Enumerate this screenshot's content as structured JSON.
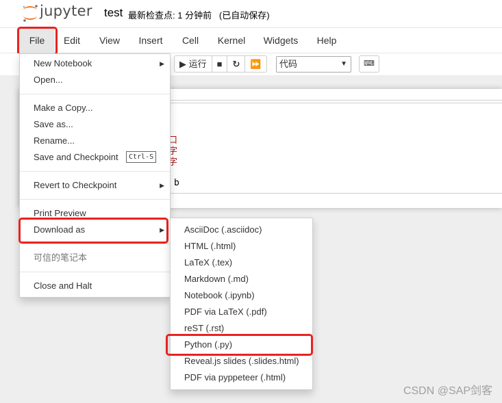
{
  "header": {
    "logo_text": "jupyter",
    "notebook_title": "test",
    "save_status": "最新检查点: 1 分钟前   (已自动保存)"
  },
  "menubar": {
    "items": [
      "File",
      "Edit",
      "View",
      "Insert",
      "Cell",
      "Kernel",
      "Widgets",
      "Help"
    ]
  },
  "toolbar": {
    "run_label": "▶ 运行",
    "stop_icon": "stop-icon",
    "restart_icon": "restart-icon",
    "fast_forward_icon": "fast-forward-icon",
    "cell_type": "代码",
    "keyboard_icon": "keyboard-icon"
  },
  "notebook": {
    "fragments": [
      "口",
      "字",
      "字",
      "b"
    ]
  },
  "file_menu": {
    "items": [
      {
        "label": "New Notebook",
        "has_submenu": true
      },
      {
        "label": "Open..."
      },
      {
        "label": "Make a Copy..."
      },
      {
        "label": "Save as..."
      },
      {
        "label": "Rename..."
      },
      {
        "label": "Save and Checkpoint",
        "shortcut": "Ctrl-S"
      },
      {
        "label": "Revert to Checkpoint",
        "has_submenu": true
      },
      {
        "label": "Print Preview"
      },
      {
        "label": "Download as",
        "has_submenu": true
      },
      {
        "label": "可信的笔记本",
        "disabled": true
      },
      {
        "label": "Close and Halt"
      }
    ]
  },
  "download_submenu": {
    "items": [
      "AsciiDoc (.asciidoc)",
      "HTML (.html)",
      "LaTeX (.tex)",
      "Markdown (.md)",
      "Notebook (.ipynb)",
      "PDF via LaTeX (.pdf)",
      "reST (.rst)",
      "Python (.py)",
      "Reveal.js slides (.slides.html)",
      "PDF via pyppeteer (.html)"
    ]
  },
  "colors": {
    "highlight": "#e8231f",
    "logo_orange": "#f37726",
    "code_red": "#a11"
  },
  "watermark": "CSDN @SAP剑客"
}
